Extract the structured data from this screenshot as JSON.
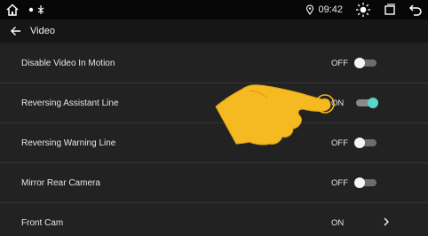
{
  "status_bar": {
    "time": "09:42",
    "icons_left": [
      "home-icon",
      "notification-icons"
    ],
    "icons_right": [
      "location-icon",
      "brightness-icon",
      "recent-apps-icon",
      "back-icon"
    ]
  },
  "header": {
    "title": "Video"
  },
  "settings": [
    {
      "label": "Disable Video In Motion",
      "value": "OFF",
      "toggle": "off"
    },
    {
      "label": "Reversing Assistant Line",
      "value": "ON",
      "toggle": "on"
    },
    {
      "label": "Reversing Warning Line",
      "value": "OFF",
      "toggle": "off"
    },
    {
      "label": "Mirror Rear Camera",
      "value": "OFF",
      "toggle": "off"
    },
    {
      "label": "Front Cam",
      "value": "ON",
      "toggle": "chevron"
    }
  ],
  "colors": {
    "accent": "#5ad6c8",
    "hand": "#f5b922"
  }
}
